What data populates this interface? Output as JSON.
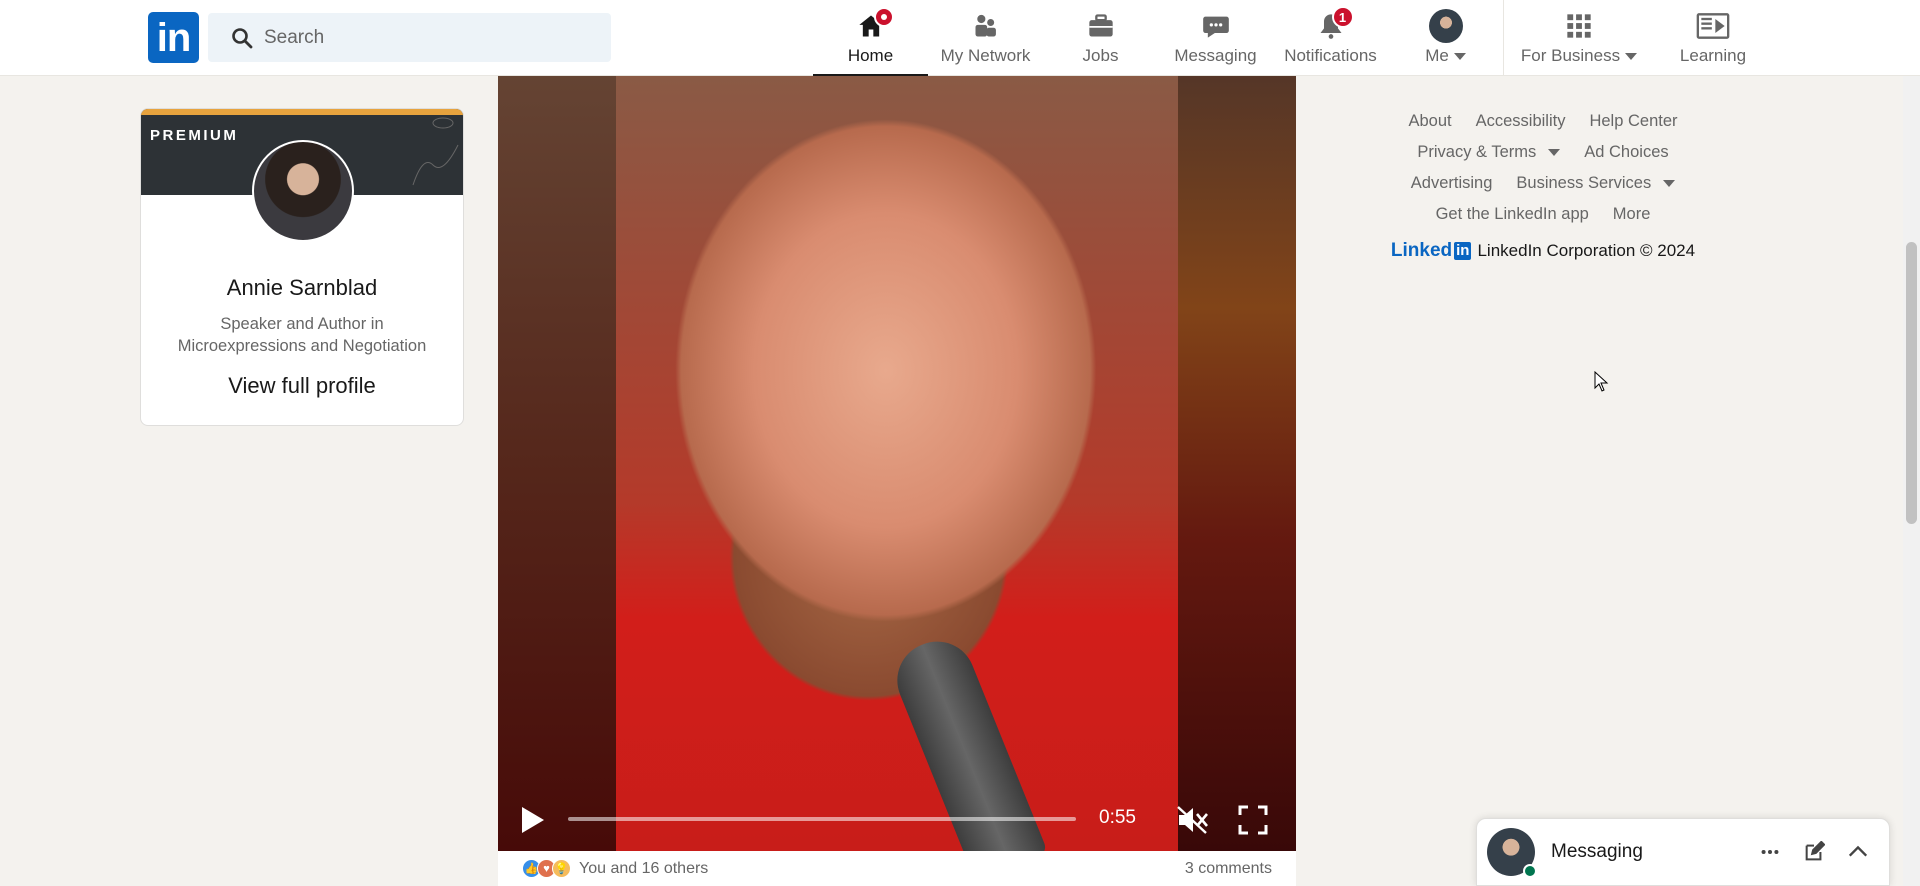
{
  "nav": {
    "search_placeholder": "Search",
    "items": [
      {
        "label": "Home"
      },
      {
        "label": "My Network"
      },
      {
        "label": "Jobs"
      },
      {
        "label": "Messaging"
      },
      {
        "label": "Notifications",
        "badge": "1"
      },
      {
        "label": "Me"
      },
      {
        "label": "For Business"
      },
      {
        "label": "Learning"
      }
    ],
    "logo_text": "in",
    "brand_color": "#0a66c2",
    "badge_color": "#cb112d"
  },
  "profile": {
    "premium_label": "PREMIUM",
    "name": "Annie Sarnblad",
    "headline": "Speaker and Author in Microexpressions and Negotiation",
    "view_label": "View full profile"
  },
  "video": {
    "time": "0:55",
    "progress": 0.0,
    "muted": true
  },
  "social": {
    "likes_text": "You and 16 others",
    "comments_text": "3 comments"
  },
  "footer": {
    "rows": [
      [
        "About",
        "Accessibility",
        "Help Center"
      ],
      [
        "Privacy & Terms",
        "Ad Choices"
      ],
      [
        "Advertising",
        "Business Services"
      ],
      [
        "Get the LinkedIn app",
        "More"
      ]
    ],
    "logo_word": "Linked",
    "logo_in": "in",
    "copyright": "LinkedIn Corporation © 2024"
  },
  "messaging": {
    "title": "Messaging"
  }
}
